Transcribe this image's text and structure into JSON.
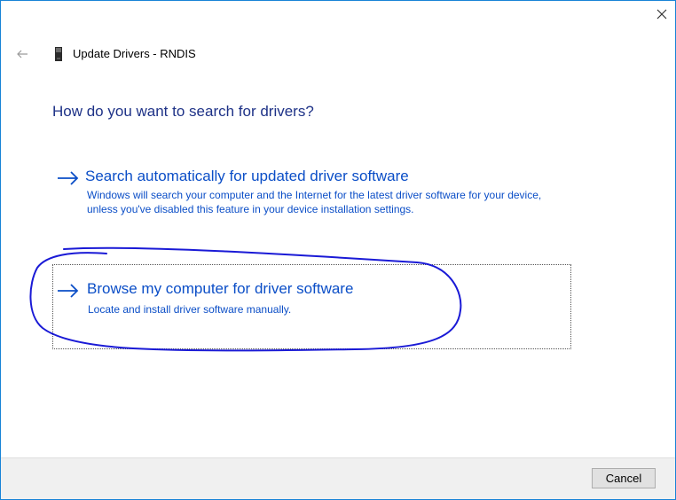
{
  "window": {
    "title": "Update Drivers - RNDIS",
    "close_icon": "close-icon",
    "back_icon": "back-arrow-icon",
    "device_icon": "device-icon"
  },
  "main": {
    "heading": "How do you want to search for drivers?",
    "options": [
      {
        "title": "Search automatically for updated driver software",
        "description": "Windows will search your computer and the Internet for the latest driver software for your device, unless you've disabled this feature in your device installation settings.",
        "icon": "arrow-right-icon"
      },
      {
        "title": "Browse my computer for driver software",
        "description": "Locate and install driver software manually.",
        "icon": "arrow-right-icon",
        "focused": true
      }
    ]
  },
  "footer": {
    "cancel_label": "Cancel"
  },
  "colors": {
    "accent": "#0b4ec7",
    "heading": "#1e3287",
    "window_border": "#1883d7",
    "annotation": "#1a1ad6",
    "footer_bg": "#f0f0f0"
  }
}
